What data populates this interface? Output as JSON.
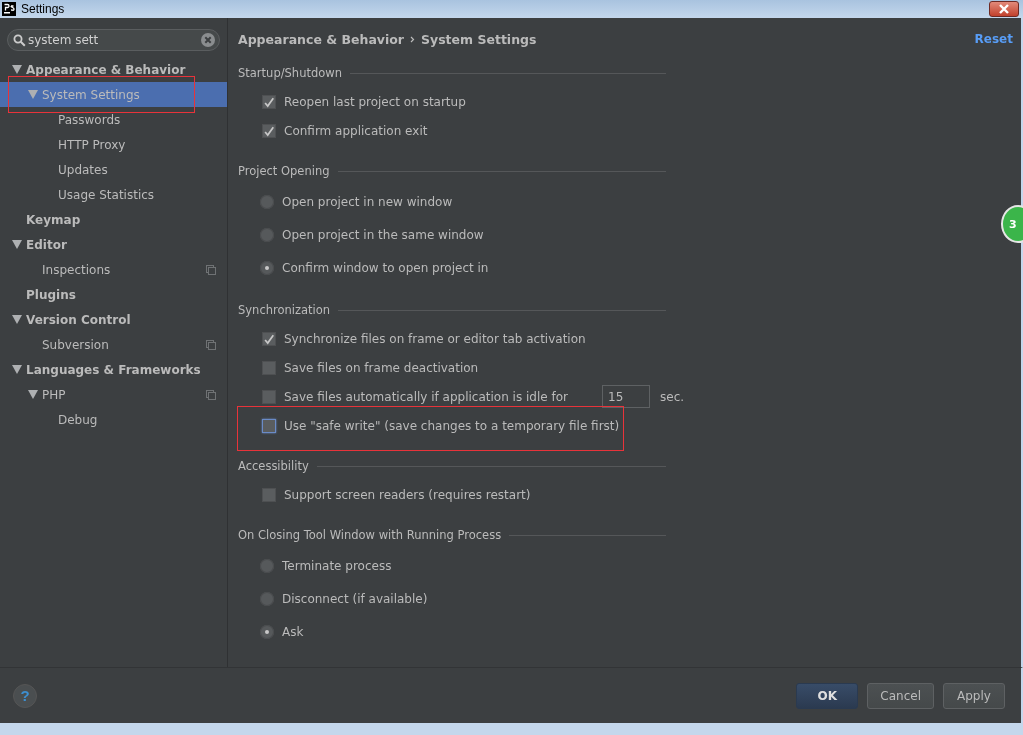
{
  "window": {
    "title": "Settings"
  },
  "search": {
    "value": "system sett"
  },
  "tree": [
    {
      "label": "Appearance & Behavior",
      "expanded": true,
      "selected": false,
      "highlighted": false,
      "project_level": false,
      "children": [
        {
          "label": "System Settings",
          "expanded": true,
          "selected": true,
          "highlighted": true,
          "project_level": false,
          "children": [
            {
              "label": "Passwords",
              "selected": false,
              "highlighted": false,
              "project_level": false
            },
            {
              "label": "HTTP Proxy",
              "selected": false,
              "highlighted": false,
              "project_level": false
            },
            {
              "label": "Updates",
              "selected": false,
              "highlighted": false,
              "project_level": false
            },
            {
              "label": "Usage Statistics",
              "selected": false,
              "highlighted": false,
              "project_level": false
            }
          ]
        }
      ]
    },
    {
      "label": "Keymap",
      "selected": false,
      "highlighted": false,
      "project_level": false
    },
    {
      "label": "Editor",
      "expanded": true,
      "selected": false,
      "highlighted": false,
      "project_level": false,
      "children": [
        {
          "label": "Inspections",
          "selected": false,
          "highlighted": false,
          "project_level": true
        }
      ]
    },
    {
      "label": "Plugins",
      "selected": false,
      "highlighted": false,
      "project_level": false
    },
    {
      "label": "Version Control",
      "expanded": true,
      "selected": false,
      "highlighted": false,
      "project_level": false,
      "children": [
        {
          "label": "Subversion",
          "selected": false,
          "highlighted": false,
          "project_level": true
        }
      ]
    },
    {
      "label": "Languages & Frameworks",
      "expanded": true,
      "selected": false,
      "highlighted": false,
      "project_level": false,
      "children": [
        {
          "label": "PHP",
          "expanded": true,
          "selected": false,
          "highlighted": false,
          "project_level": true,
          "children": [
            {
              "label": "Debug",
              "selected": false,
              "highlighted": false,
              "project_level": false
            }
          ]
        }
      ]
    }
  ],
  "breadcrumb": [
    "Appearance & Behavior",
    "System Settings"
  ],
  "reset_link": "Reset",
  "sections": [
    {
      "title": "Startup/Shutdown",
      "options": [
        {
          "kind": "checkbox",
          "label": "Reopen last project on startup",
          "checked": true,
          "highlighted": false
        },
        {
          "kind": "checkbox",
          "label": "Confirm application exit",
          "checked": true,
          "highlighted": false
        }
      ]
    },
    {
      "title": "Project Opening",
      "options": [
        {
          "kind": "radio",
          "label": "Open project in new window",
          "selected": false
        },
        {
          "kind": "radio",
          "label": "Open project in the same window",
          "selected": false
        },
        {
          "kind": "radio",
          "label": "Confirm window to open project in",
          "selected": true
        }
      ]
    },
    {
      "title": "Synchronization",
      "options": [
        {
          "kind": "checkbox",
          "label": "Synchronize files on frame or editor tab activation",
          "checked": true,
          "highlighted": false
        },
        {
          "kind": "checkbox",
          "label": "Save files on frame deactivation",
          "checked": false,
          "highlighted": false
        },
        {
          "kind": "checkbox",
          "label": "Save files automatically if application is idle for",
          "checked": false,
          "highlighted": false,
          "field_value": "15",
          "suffix": "sec."
        },
        {
          "kind": "checkbox",
          "label": "Use \"safe write\" (save changes to a temporary file first)",
          "checked": false,
          "highlighted": true
        }
      ]
    },
    {
      "title": "Accessibility",
      "options": [
        {
          "kind": "checkbox",
          "label": "Support screen readers (requires restart)",
          "checked": false,
          "highlighted": false
        }
      ]
    },
    {
      "title": "On Closing Tool Window with Running Process",
      "options": [
        {
          "kind": "radio",
          "label": "Terminate process",
          "selected": false
        },
        {
          "kind": "radio",
          "label": "Disconnect (if available)",
          "selected": false
        },
        {
          "kind": "radio",
          "label": "Ask",
          "selected": true
        }
      ]
    }
  ],
  "badge": "3",
  "help_button": "?",
  "buttons": [
    {
      "label": "OK",
      "default": true
    },
    {
      "label": "Cancel",
      "default": false
    },
    {
      "label": "Apply",
      "default": false
    }
  ]
}
